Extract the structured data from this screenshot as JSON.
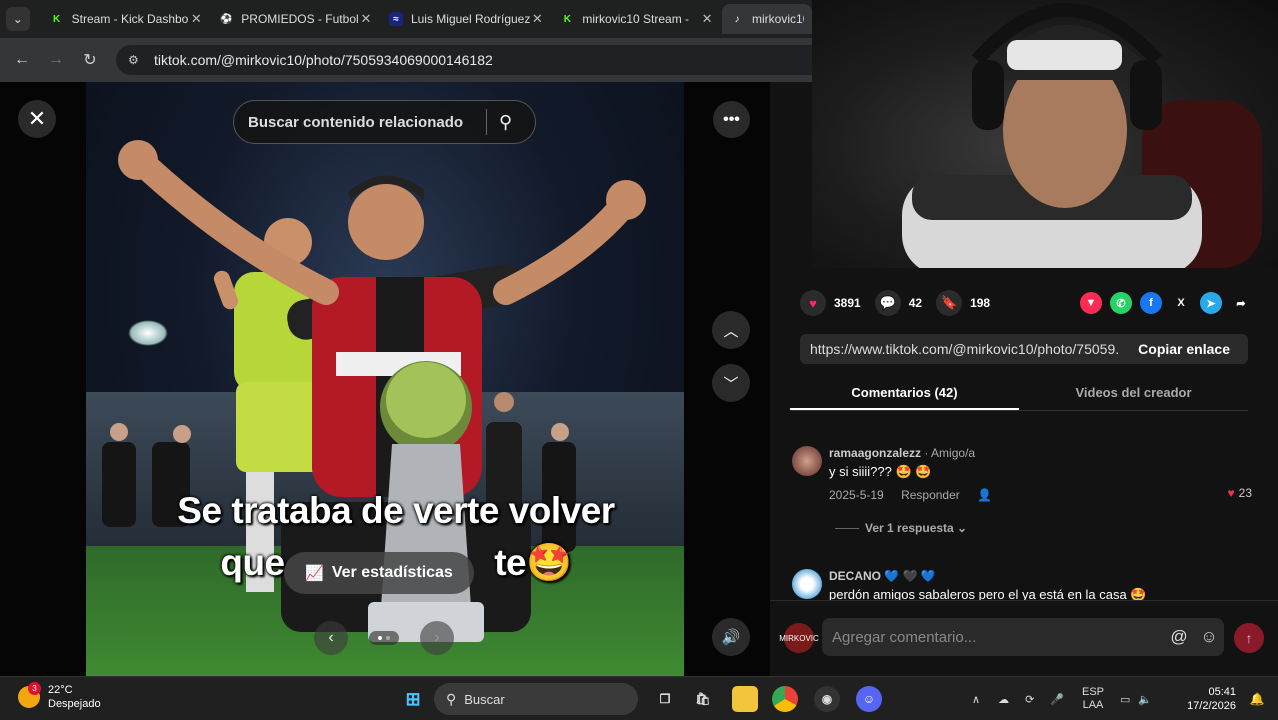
{
  "browser": {
    "tabs": [
      {
        "title": "Stream - Kick Dashbo",
        "favicon_color": "#53fc18",
        "favicon": "K"
      },
      {
        "title": "PROMIEDOS - Futbol",
        "favicon_color": "#2e7d32",
        "favicon": "⚽"
      },
      {
        "title": "Luis Miguel Rodríguez",
        "favicon_color": "#1a237e",
        "favicon": "≈"
      },
      {
        "title": "mirkovic10 Stream - ",
        "favicon_color": "#53fc18",
        "favicon": "K"
      },
      {
        "title": "mirkovic10",
        "favicon_color": "#111111",
        "favicon": "♪",
        "active": true
      }
    ],
    "url": "tiktok.com/@mirkovic10/photo/7505934069000146182"
  },
  "viewer": {
    "search_placeholder": "Buscar contenido relacionado",
    "caption_line1": "Se trataba de verte volver",
    "caption_line2_start": "que",
    "caption_line2_end": "te🤩",
    "stats_label": "Ver estadísticas"
  },
  "actions": {
    "likes": "3891",
    "comments": "42",
    "saves": "198",
    "link": "https://www.tiktok.com/@mirkovic10/photo/75059...",
    "copy_label": "Copiar enlace"
  },
  "panel_tabs": [
    {
      "label": "Comentarios (42)",
      "active": true
    },
    {
      "label": "Videos del creador",
      "active": false
    }
  ],
  "comments": [
    {
      "user": "ramaagonzalezz",
      "tag": " · Amigo/a",
      "text": "y si siiii??? 🤩 🤩",
      "date": "2025-5-19",
      "reply": "Responder",
      "likes": "23",
      "replies": "Ver 1 respuesta ⌄"
    },
    {
      "user": "DECANO",
      "tag": " 💙 🖤 💙",
      "text": "perdón amigos sabaleros pero el ya está en la casa 🤩"
    }
  ],
  "composer": {
    "placeholder": "Agregar comentario...",
    "avatar_text": "MIRKOVIC"
  },
  "taskbar": {
    "temperature": "22°C",
    "weather": "Despejado",
    "weather_badge": "3",
    "search_label": "Buscar",
    "lang1": "ESP",
    "lang2": "LAA",
    "time": "05:41",
    "date": "17/2/2026"
  },
  "colors": {
    "like_red": "#fe2c55",
    "kick_green": "#53fc18",
    "panel_bg": "#121212"
  }
}
